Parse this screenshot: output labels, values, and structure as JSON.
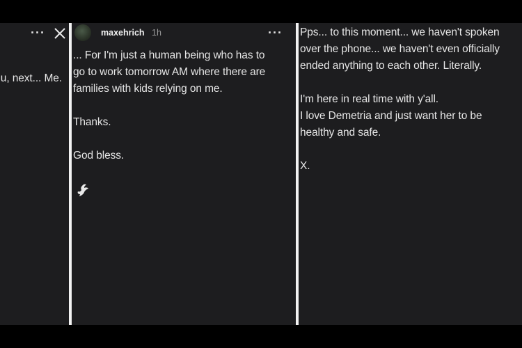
{
  "left_panel": {
    "text": "u, next... Me."
  },
  "middle_panel": {
    "username": "maxehrich",
    "time": "1h",
    "paragraphs": [
      "... For I'm just a human being who has to\ngo to work tomorrow AM where there are\nfamilies with kids relying on me.",
      "Thanks.",
      "God bless."
    ]
  },
  "right_panel": {
    "paragraphs": [
      "Pps... to this moment... we haven't spoken\nover the phone... we haven't even officially\nended anything to each other. Literally.",
      "I'm here in real time with y'all.\nI love Demetria and just want her to be\nhealthy and safe.",
      "X."
    ]
  },
  "icons": {
    "more": "more-dots-icon",
    "close": "close-icon",
    "dove": "dove-icon"
  }
}
